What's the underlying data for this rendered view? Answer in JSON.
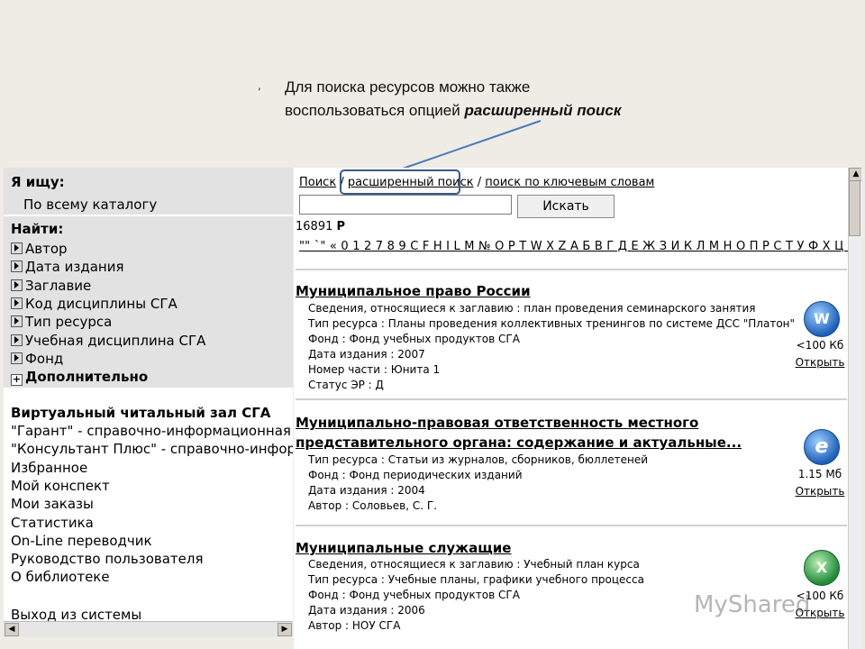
{
  "caption": {
    "line1": "Для поиска ресурсов можно также",
    "line2_prefix": "воспользоваться опцией ",
    "line2_emphasis": "расширенный поиск",
    "tick": ","
  },
  "left_panel": {
    "looking_for_label": "Я ищу:",
    "looking_for_value": "По всему каталогу",
    "find_label": "Найти:",
    "find_items": [
      "Автор",
      "Дата издания",
      "Заглавие",
      "Код дисциплины СГА",
      "Тип ресурса",
      "Учебная дисциплина СГА",
      "Фонд"
    ],
    "more_label": "Дополнительно",
    "reading_room": "Виртуальный читальный зал СГА",
    "links": [
      "\"Гарант\" - справочно-информационная с",
      "\"Консультант Плюс\" - справочно-информ",
      "Избранное",
      "Мой конспект",
      "Мои заказы",
      "Статистика",
      "On-Line переводчик",
      "Руководство пользователя",
      "О библиотеке"
    ],
    "logout": "Выход из системы"
  },
  "search": {
    "simple": "Поиск",
    "slash": "/",
    "advanced": "расширенный поиск",
    "keywords": "поиск по ключевым словам",
    "input_value": "",
    "button": "Искать",
    "count": "16891",
    "count_letter": "Р"
  },
  "alphabet": "\"\" `\" « 0 1 2 7 8 9 C F H I L M № O P T W X Z А Б В Г Д Е Ж З И К Л М Н О П Р С Т У Ф Х Ц Ч Ш Э Ю Я",
  "results": [
    {
      "title": "Муниципальное право России",
      "details": [
        "Сведения, относящиеся к заглавию  :  план проведения семинарского занятия",
        "Тип ресурса  :  Планы проведения коллективных тренингов по системе ДСС \"Платон\"",
        "Фонд  :  Фонд учебных продуктов СГА",
        "Дата издания  :  2007",
        "Номер части  :  Юнита 1",
        "Статус ЭР  :  Д"
      ],
      "icon": "word-doc-icon",
      "icon_glyph": "W",
      "size": "<100 Кб",
      "open": "Открыть"
    },
    {
      "title": "Муниципально-правовая ответственность местного",
      "title2": "представительного органа: содержание и актуальные...",
      "details": [
        "Тип ресурса  :  Статьи из журналов, сборников, бюллетеней",
        "Фонд  :  Фонд периодических изданий",
        "Дата издания  :  2004",
        "Автор  :  Соловьев, С. Г."
      ],
      "icon": "internet-explorer-icon",
      "icon_glyph": "e",
      "size": "1.15 Мб",
      "open": "Открыть"
    },
    {
      "title": "Муниципальные служащие",
      "details": [
        "Сведения, относящиеся к заглавию  :  Учебный план курса",
        "Тип ресурса  :  Учебные планы, графики учебного процесса",
        "Фонд  :  Фонд учебных продуктов СГА",
        "Дата издания  :  2006",
        "Автор  :  НОУ СГА"
      ],
      "icon": "excel-doc-icon",
      "icon_glyph": "X",
      "size": "<100 Кб",
      "open": "Открыть"
    }
  ],
  "watermark": "MyShared"
}
